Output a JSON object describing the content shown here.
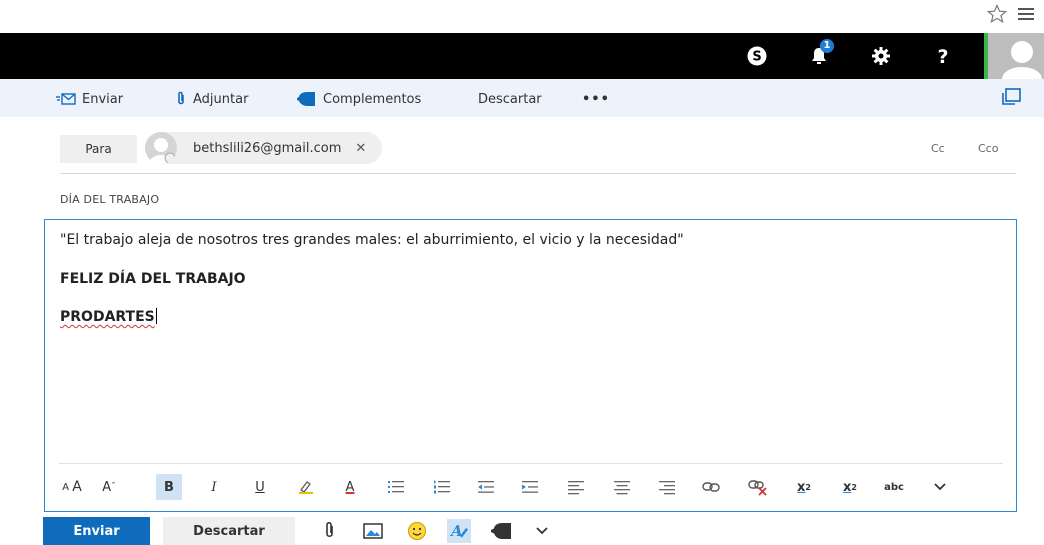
{
  "toolbar": {
    "send_label": "Enviar",
    "attach_label": "Adjuntar",
    "addins_label": "Complementos",
    "discard_label": "Descartar",
    "more_label": "•••"
  },
  "header": {
    "notification_count": "1"
  },
  "recipients": {
    "to_label": "Para",
    "to_chip_email": "bethslili26@gmail.com",
    "remove_glyph": "✕",
    "cc_label": "Cc",
    "bcc_label": "Cco"
  },
  "subject": "DÍA DEL TRABAJO",
  "body": {
    "line1": "\"El trabajo aleja de nosotros tres grandes males: el aburrimiento, el vicio y la necesidad\"",
    "line2": "FELIZ DÍA DEL TRABAJO",
    "line3": "PRODARTES"
  },
  "format_toolbar": {
    "font_size_label": "AA",
    "grow_font_label": "A",
    "bold_label": "B",
    "italic_label": "I",
    "underline_label": "U",
    "font_color_label": "A",
    "superscript_label": "x",
    "superscript_mark": "2",
    "subscript_label": "x",
    "subscript_mark": "2",
    "strikethrough_label": "abc"
  },
  "actions": {
    "send_label": "Enviar",
    "discard_label": "Descartar"
  },
  "colors": {
    "accent": "#0f6cbd",
    "header_bg": "#000000",
    "toolbar_bg": "#eef3fb",
    "presence": "#3cb54a",
    "spell_error": "#d13438"
  }
}
